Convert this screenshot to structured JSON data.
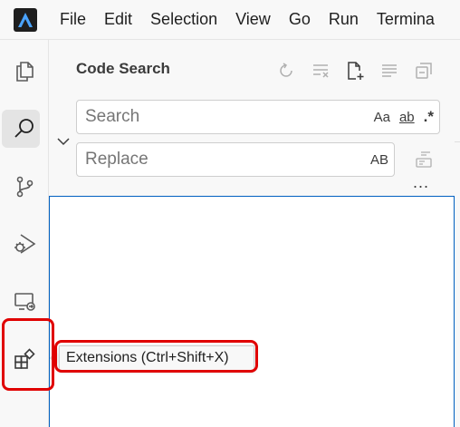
{
  "menubar": {
    "logo_icon": "app-logo-icon",
    "items": [
      "File",
      "Edit",
      "Selection",
      "View",
      "Go",
      "Run",
      "Termina"
    ]
  },
  "activitybar": {
    "items": [
      {
        "name": "explorer",
        "icon": "files-icon"
      },
      {
        "name": "search",
        "icon": "search-icon",
        "active": true
      },
      {
        "name": "source-control",
        "icon": "source-control-icon"
      },
      {
        "name": "run-debug",
        "icon": "run-debug-icon"
      },
      {
        "name": "remote-explorer",
        "icon": "remote-explorer-icon"
      },
      {
        "name": "extensions",
        "icon": "extensions-icon"
      }
    ]
  },
  "panel": {
    "title": "Code Search",
    "actions": [
      "refresh-icon",
      "clear-results-icon",
      "new-search-editor-icon",
      "view-as-tree-icon",
      "collapse-all-icon"
    ]
  },
  "search": {
    "placeholder": "Search",
    "value": "",
    "match_case": "Aa",
    "whole_word": "ab",
    "regex": ".*"
  },
  "replace": {
    "placeholder": "Replace",
    "value": "",
    "preserve_case": "AB"
  },
  "more_label": "...",
  "tooltip": {
    "text": "Extensions (Ctrl+Shift+X)"
  },
  "colors": {
    "highlight": "#e00000",
    "focus_border": "#0060c0",
    "logo": "#0078d4"
  }
}
